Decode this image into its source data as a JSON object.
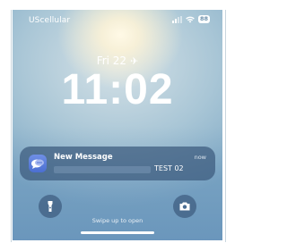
{
  "status_bar": {
    "carrier": "UScellular",
    "battery_level": "88"
  },
  "lock_screen": {
    "date": "Fri 22",
    "time": "11:02",
    "swipe_hint": "Swipe up to open"
  },
  "notification": {
    "title": "New Message",
    "time": "now",
    "body": "TEST 02"
  },
  "quick_actions": {
    "left": "flashlight-icon",
    "right": "camera-icon"
  },
  "colors": {
    "notification_bg": "#3c5a7d",
    "app_icon": "#5a7ddc"
  }
}
